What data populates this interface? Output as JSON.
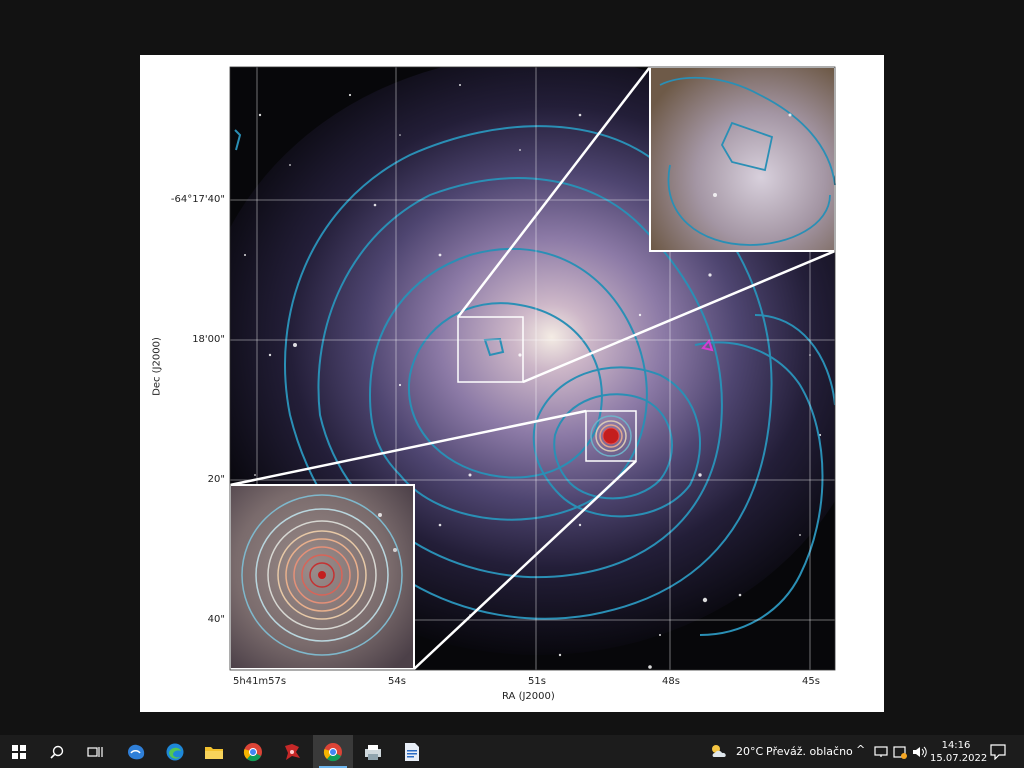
{
  "figure": {
    "axes": {
      "xlabel": "RA (J2000)",
      "ylabel": "Dec (J2000)",
      "x_ticks": [
        "5h41m57s",
        "54s",
        "51s",
        "48s",
        "45s"
      ],
      "y_ticks": [
        "-64°17'40\"",
        "18'00\"",
        "20\"",
        "40\""
      ]
    },
    "insets": [
      "zoom-inset-top-right",
      "zoom-inset-bottom-left"
    ],
    "colors": {
      "contour_blue": "#2a8fb5",
      "contour_inner": "#d9c9b5",
      "core_red": "#c41e1e",
      "marker_magenta": "#d23cd2",
      "frame_white": "#ffffff"
    }
  },
  "taskbar": {
    "weather": {
      "temp": "20°C",
      "condition": "Převáž. oblačno"
    },
    "clock": {
      "time": "14:16",
      "date": "15.07.2022"
    },
    "apps": [
      "windows-start",
      "search",
      "task-view",
      "edge-legacy",
      "edge",
      "file-explorer",
      "chrome",
      "app-red",
      "chrome-active",
      "printer-app",
      "notepad-app"
    ]
  }
}
